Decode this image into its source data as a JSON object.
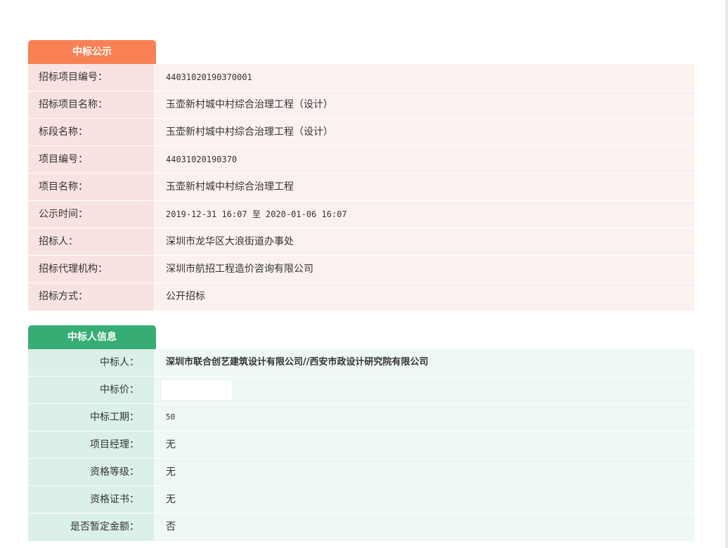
{
  "notice": {
    "tab_label": "中标公示",
    "rows": [
      {
        "label": "招标项目编号：",
        "value": "44031020190370001"
      },
      {
        "label": "招标项目名称：",
        "value": "玉壶新村城中村综合治理工程（设计）"
      },
      {
        "label": "标段名称：",
        "value": "玉壶新村城中村综合治理工程（设计）"
      },
      {
        "label": "项目编号：",
        "value": "44031020190370"
      },
      {
        "label": "项目名称：",
        "value": "玉壶新村城中村综合治理工程"
      },
      {
        "label": "公示时间：",
        "value": "2019-12-31 16:07 至 2020-01-06 16:07"
      },
      {
        "label": "招标人：",
        "value": "深圳市龙华区大浪街道办事处"
      },
      {
        "label": "招标代理机构：",
        "value": "深圳市航招工程造价咨询有限公司"
      },
      {
        "label": "招标方式：",
        "value": "公开招标"
      }
    ]
  },
  "winner": {
    "tab_label": "中标人信息",
    "rows": [
      {
        "label": "中标人：",
        "value": "深圳市联合创艺建筑设计有限公司//西安市政设计研究院有限公司"
      },
      {
        "label": "中标价：",
        "value": ""
      },
      {
        "label": "中标工期：",
        "value": "50"
      },
      {
        "label": "项目经理：",
        "value": "无"
      },
      {
        "label": "资格等级：",
        "value": "无"
      },
      {
        "label": "资格证书：",
        "value": "无"
      },
      {
        "label": "是否暂定金额：",
        "value": "否"
      }
    ]
  }
}
